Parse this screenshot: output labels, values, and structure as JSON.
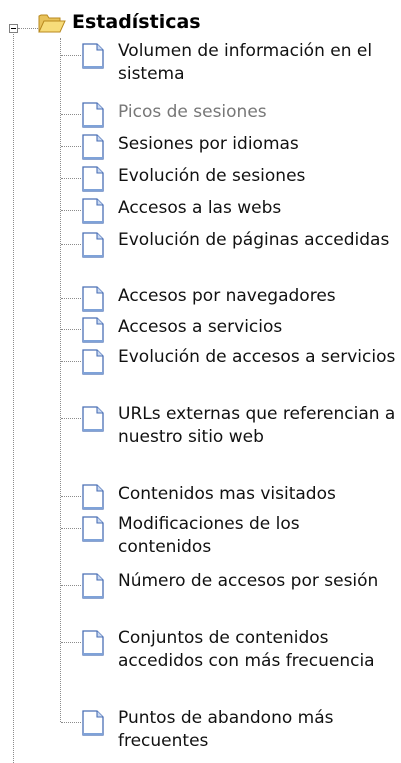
{
  "tree": {
    "root": {
      "label": "Estadísticas",
      "expanded": true,
      "expander_symbol": "minus",
      "icon": "folder-open-icon"
    },
    "items": [
      {
        "label": "Volumen de información en el sistema",
        "icon": "document-icon"
      },
      {
        "label": "Picos de sesiones",
        "icon": "document-icon",
        "dimmed": true
      },
      {
        "label": "Sesiones por idiomas",
        "icon": "document-icon"
      },
      {
        "label": "Evolución de sesiones",
        "icon": "document-icon"
      },
      {
        "label": "Accesos a las webs",
        "icon": "document-icon"
      },
      {
        "label": "Evolución de páginas accedidas",
        "icon": "document-icon"
      },
      {
        "label": "Accesos por navegadores",
        "icon": "document-icon"
      },
      {
        "label": "Accesos a servicios",
        "icon": "document-icon"
      },
      {
        "label": "Evolución de accesos a servicios",
        "icon": "document-icon"
      },
      {
        "label": "URLs externas que referencian a nuestro sitio web",
        "icon": "document-icon"
      },
      {
        "label": "Contenidos mas visitados",
        "icon": "document-icon"
      },
      {
        "label": "Modificaciones de los contenidos",
        "icon": "document-icon"
      },
      {
        "label": "Número de accesos por sesión",
        "icon": "document-icon"
      },
      {
        "label": "Conjuntos de contenidos accedidos con más frecuencia",
        "icon": "document-icon"
      },
      {
        "label": "Puntos de abandono más frecuentes",
        "icon": "document-icon"
      }
    ]
  },
  "colors": {
    "folder_fill": "#f6d66b",
    "folder_stroke": "#c89a2a",
    "doc_fill": "#ffffff",
    "doc_stroke": "#4a6fb5",
    "doc_fold": "#c9d9f2",
    "guide_line": "#8c8c8c"
  }
}
